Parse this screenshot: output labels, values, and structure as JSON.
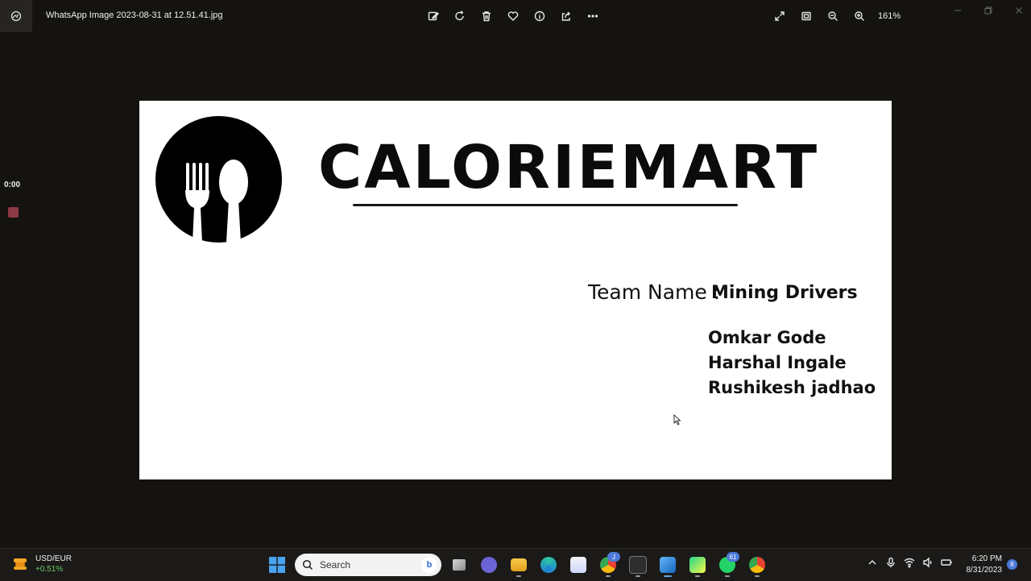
{
  "window": {
    "file_title": "WhatsApp Image 2023-08-31 at 12.51.41.jpg",
    "zoom_level": "161%"
  },
  "toolbar": {
    "items": [
      "edit-icon",
      "rotate-icon",
      "delete-icon",
      "favorite-icon",
      "info-icon",
      "share-icon",
      "more-icon"
    ]
  },
  "recording": {
    "time": "0:00",
    "stop_color": "#8c3a44"
  },
  "image": {
    "brand": "CALORIEMART",
    "team_label": "Team Name :",
    "team_name": "Mining Drivers",
    "members": [
      "Omkar Gode",
      "Harshal Ingale",
      "Rushikesh jadhao"
    ]
  },
  "taskbar": {
    "widget": {
      "pair": "USD/EUR",
      "change": "+0.51%"
    },
    "search_placeholder": "Search",
    "chrome_badge": "J",
    "whatsapp_badge": "61",
    "clock": {
      "time": "6:20 PM",
      "date": "8/31/2023"
    },
    "notification_count": "8"
  },
  "colors": {
    "background": "#141310",
    "canvas": "#ffffff",
    "taskbar": "#1b1a18",
    "accent": "#4b79d8"
  }
}
